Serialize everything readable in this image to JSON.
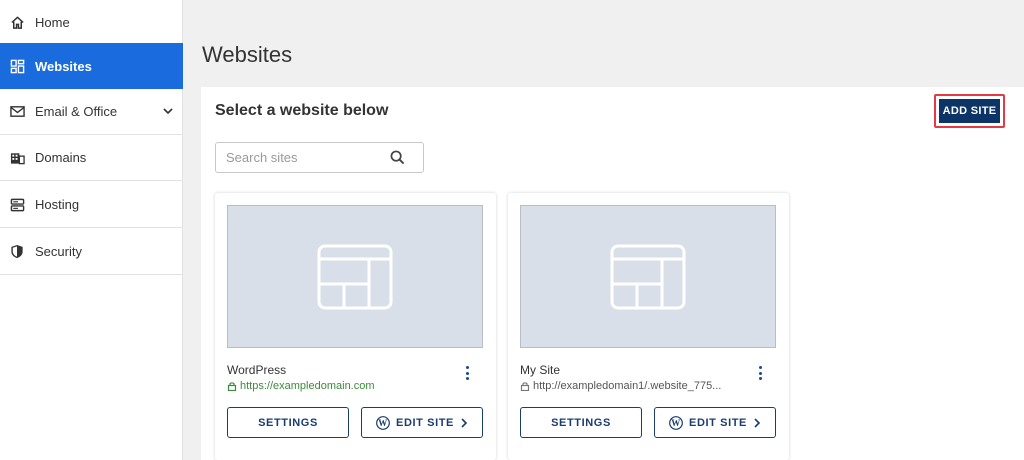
{
  "sidebar": {
    "items": [
      {
        "label": "Home",
        "icon": "home-icon"
      },
      {
        "label": "Websites",
        "icon": "websites-grid-icon",
        "active": true
      },
      {
        "label": "Email & Office",
        "icon": "envelope-icon",
        "expandable": true
      },
      {
        "label": "Domains",
        "icon": "domains-building-icon"
      },
      {
        "label": "Hosting",
        "icon": "server-icon"
      },
      {
        "label": "Security",
        "icon": "shield-icon"
      }
    ],
    "active_color": "#196bde"
  },
  "main": {
    "title": "Websites",
    "panel_heading": "Select a website below",
    "add_site_label": "ADD SITE",
    "search_placeholder": "Search sites",
    "sites": [
      {
        "name": "WordPress",
        "url_protocol": "https://",
        "url_rest": "exampledomain.com",
        "secure": true,
        "settings_label": "SETTINGS",
        "edit_label": "EDIT SITE"
      },
      {
        "name": "My Site",
        "url_protocol": "http://",
        "url_rest": "exampledomain1/.website_775...",
        "secure": false,
        "settings_label": "SETTINGS",
        "edit_label": "EDIT SITE"
      }
    ]
  },
  "colors": {
    "primary_dark": "#0d3466",
    "highlight_outline": "#e53945",
    "secure_green": "#3a8c3a"
  }
}
